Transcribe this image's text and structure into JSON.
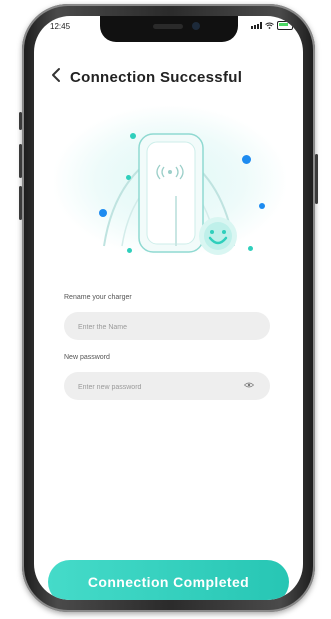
{
  "status_bar": {
    "time": "12:45"
  },
  "header": {
    "title": "Connection Successful"
  },
  "form": {
    "rename_label": "Rename your charger",
    "rename_placeholder": "Enter the Name",
    "password_label": "New password",
    "password_placeholder": "Enter new password"
  },
  "cta": {
    "label": "Connection Completed"
  },
  "colors": {
    "accent": "#2fcfbc",
    "accent_dot": "#1d8bf0",
    "field_bg": "#eeeeee"
  },
  "icons": {
    "back": "chevron-left-icon",
    "wireless": "wireless-signal-icon",
    "smile": "smiley-face-icon",
    "eye": "eye-icon"
  }
}
